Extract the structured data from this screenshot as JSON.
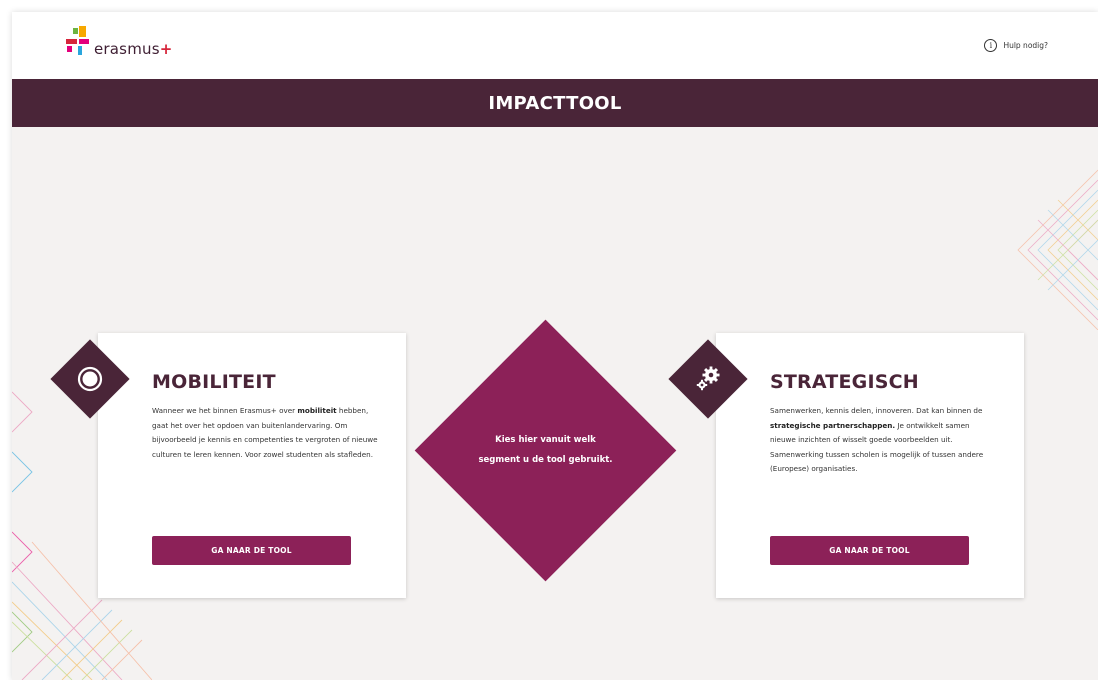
{
  "header": {
    "logo_text": "erasmus",
    "logo_plus": "+",
    "help_label": "Hulp nodig?",
    "help_icon": "info-icon"
  },
  "banner": {
    "title": "IMPACTTOOL"
  },
  "center": {
    "line1": "Kies hier vanuit welk",
    "line2": "segment u de tool gebruikt."
  },
  "cards": {
    "mobiliteit": {
      "title": "MOBILITEIT",
      "icon": "circle-target-icon",
      "body_p1": "Wanneer we het binnen Erasmus+ over ",
      "body_bold1": "mobiliteit",
      "body_p2": " hebben, gaat het over het opdoen van buitenlandervaring. Om bijvoorbeeld je kennis en competenties te vergroten of nieuwe culturen te leren kennen. Voor zowel studenten als stafleden.",
      "button": "GA NAAR DE TOOL"
    },
    "strategisch": {
      "title": "STRATEGISCH",
      "icon": "gears-icon",
      "body_p1": "Samenwerken, kennis delen, innoveren. Dat kan binnen de ",
      "body_bold1": "strategische partnerschappen.",
      "body_p2": " Je ontwikkelt samen nieuwe inzichten of wisselt goede voorbeelden uit. Samenwerking tussen scholen is mogelijk of tussen andere (Europese) organisaties.",
      "button": "GA NAAR DE TOOL"
    }
  },
  "colors": {
    "plum": "#4a2538",
    "magenta": "#8c2158",
    "background": "#f4f2f1"
  }
}
